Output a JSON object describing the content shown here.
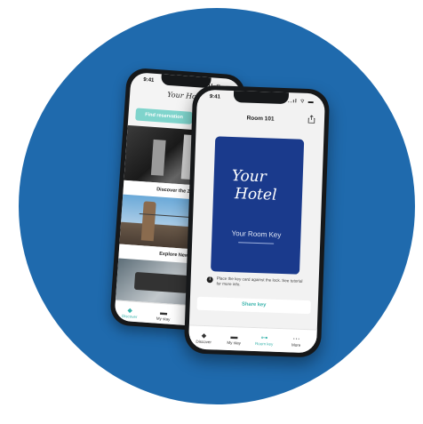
{
  "status": {
    "time": "9:41",
    "icons": "..ıl ⌔ ▬"
  },
  "back_phone": {
    "logo": "Your Hotel",
    "find_button": "Find reservation",
    "captions": [
      "Discover the Zaplo",
      "Explore New"
    ],
    "tabs": [
      {
        "icon": "tag-icon",
        "label": "Discover"
      },
      {
        "icon": "bed-icon",
        "label": "My stay"
      },
      {
        "icon": "more-icon",
        "label": ""
      }
    ]
  },
  "front_phone": {
    "title": "Room 101",
    "card_logo_line1": "Your",
    "card_logo_line2": "Hotel",
    "card_label": "Your Room Key",
    "info_text": "Place the key card against the lock. See tutorial for more info.",
    "share_button": "Share key",
    "tabs": [
      {
        "icon": "tag-icon",
        "label": "Discover"
      },
      {
        "icon": "bed-icon",
        "label": "My stay"
      },
      {
        "icon": "key-icon",
        "label": "Room key"
      },
      {
        "icon": "more-icon",
        "label": "More"
      }
    ]
  },
  "colors": {
    "background_circle": "#1f6aad",
    "card": "#1a3a8c",
    "accent": "#3bb4ad"
  }
}
